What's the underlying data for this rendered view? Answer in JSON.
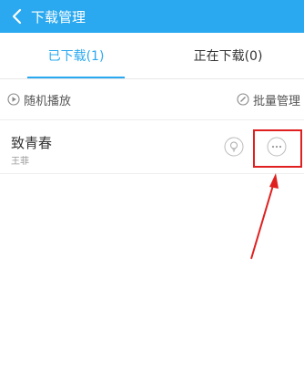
{
  "header": {
    "title": "下载管理",
    "back_icon": "chevron-left-icon"
  },
  "tabs": [
    {
      "label": "已下载(1)",
      "active": true
    },
    {
      "label": "正在下载(0)",
      "active": false
    }
  ],
  "toolbar": {
    "shuffle_label": "随机播放",
    "shuffle_icon": "play-circle-icon",
    "batch_label": "批量管理",
    "batch_icon": "edit-icon"
  },
  "songs": [
    {
      "title": "致青春",
      "artist": "王菲",
      "actions": [
        "lightbulb-icon",
        "more-icon"
      ]
    }
  ],
  "colors": {
    "accent": "#2aa9f0",
    "annotation": "#e02020"
  }
}
